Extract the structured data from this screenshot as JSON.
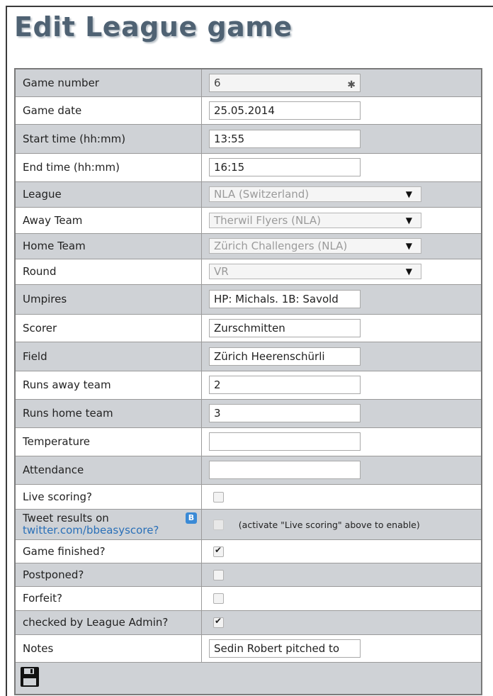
{
  "page": {
    "title": "Edit League game"
  },
  "fields": {
    "game_number": {
      "label": "Game number",
      "value": "6"
    },
    "game_date": {
      "label": "Game date",
      "value": "25.05.2014"
    },
    "start_time": {
      "label": "Start time (hh:mm)",
      "value": "13:55"
    },
    "end_time": {
      "label": "End time (hh:mm)",
      "value": "16:15"
    },
    "league": {
      "label": "League",
      "value": "NLA (Switzerland)"
    },
    "away_team": {
      "label": "Away Team",
      "value": "Therwil Flyers (NLA)"
    },
    "home_team": {
      "label": "Home Team",
      "value": "Zürich Challengers (NLA)"
    },
    "round": {
      "label": "Round",
      "value": "VR"
    },
    "umpires": {
      "label": "Umpires",
      "value": "HP: Michals. 1B: Savold"
    },
    "scorer": {
      "label": "Scorer",
      "value": "Zurschmitten"
    },
    "field": {
      "label": "Field",
      "value": "Zürich Heerenschürli"
    },
    "runs_away": {
      "label": "Runs away team",
      "value": "2"
    },
    "runs_home": {
      "label": "Runs home team",
      "value": "3"
    },
    "temperature": {
      "label": "Temperature",
      "value": ""
    },
    "attendance": {
      "label": "Attendance",
      "value": ""
    },
    "live_scoring": {
      "label": "Live scoring?",
      "checked": false
    },
    "tweet_results": {
      "label": "Tweet results on",
      "link": "twitter.com/bbeasyscore?",
      "hint": "(activate \"Live scoring\" above to enable)",
      "checked": false,
      "disabled": true
    },
    "game_finished": {
      "label": "Game finished?",
      "checked": true
    },
    "postponed": {
      "label": "Postponed?",
      "checked": false
    },
    "forfeit": {
      "label": "Forfeit?",
      "checked": false
    },
    "checked_by_admin": {
      "label": "checked by League Admin?",
      "checked": true
    },
    "notes": {
      "label": "Notes",
      "value": "Sedin Robert pitched to"
    }
  },
  "icons": {
    "save": "floppy-disk-icon",
    "twitter": "twitter-icon",
    "game_number_tool": "sparkle-icon"
  }
}
